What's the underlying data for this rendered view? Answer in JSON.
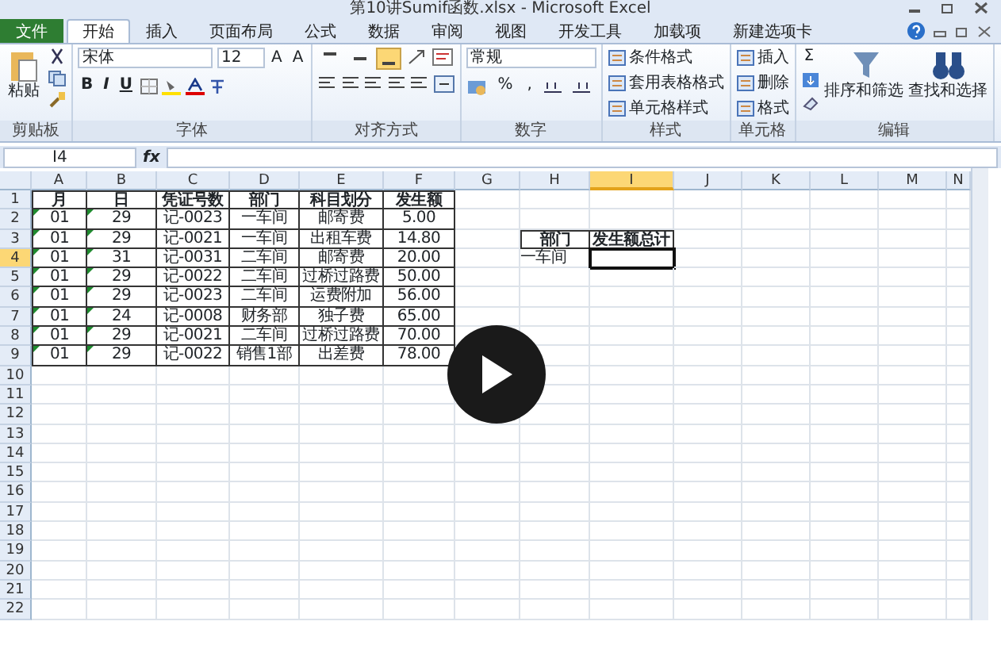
{
  "window": {
    "title": "第10讲Sumif函数.xlsx - Microsoft Excel"
  },
  "tabs": [
    {
      "label": "文件",
      "kind": "file",
      "selected": false
    },
    {
      "label": "开始",
      "kind": "tab",
      "selected": true
    },
    {
      "label": "插入",
      "kind": "tab",
      "selected": false
    },
    {
      "label": "页面布局",
      "kind": "tab",
      "selected": false
    },
    {
      "label": "公式",
      "kind": "tab",
      "selected": false
    },
    {
      "label": "数据",
      "kind": "tab",
      "selected": false
    },
    {
      "label": "审阅",
      "kind": "tab",
      "selected": false
    },
    {
      "label": "视图",
      "kind": "tab",
      "selected": false
    },
    {
      "label": "开发工具",
      "kind": "tab",
      "selected": false
    },
    {
      "label": "加载项",
      "kind": "tab",
      "selected": false
    },
    {
      "label": "新建选项卡",
      "kind": "tab",
      "selected": false
    }
  ],
  "ribbon": [
    {
      "label": "剪贴板",
      "kind": "clipboard",
      "command": "粘贴"
    },
    {
      "label": "字体",
      "kind": "font",
      "font_name": "宋体",
      "font_size": "12",
      "size_buttons": [
        "A",
        "A"
      ],
      "buttons": [
        "B",
        "I",
        "U"
      ]
    },
    {
      "label": "对齐方式",
      "kind": "alignment",
      "vertical_align": [
        {
          "selected": false
        },
        {
          "selected": false
        },
        {
          "selected": true
        }
      ]
    },
    {
      "label": "数字",
      "kind": "number",
      "format": "常规",
      "buttons": [
        "%",
        ","
      ]
    },
    {
      "label": "样式",
      "kind": "list",
      "items": [
        "条件格式",
        "套用表格格式",
        "单元格样式"
      ]
    },
    {
      "label": "单元格",
      "kind": "list",
      "items": [
        "插入",
        "删除",
        "格式"
      ]
    },
    {
      "label": "编辑",
      "kind": "editing",
      "sum": "Σ",
      "commands": [
        "排序和筛选",
        "查找和选择"
      ]
    }
  ],
  "formula_bar": {
    "name_box": "I4",
    "fx": "fx"
  },
  "columns": [
    {
      "label": "A",
      "selected": false
    },
    {
      "label": "B",
      "selected": false
    },
    {
      "label": "C",
      "selected": false
    },
    {
      "label": "D",
      "selected": false
    },
    {
      "label": "E",
      "selected": false
    },
    {
      "label": "F",
      "selected": false
    },
    {
      "label": "G",
      "selected": false
    },
    {
      "label": "H",
      "selected": false
    },
    {
      "label": "I",
      "selected": true
    },
    {
      "label": "J",
      "selected": false
    },
    {
      "label": "K",
      "selected": false
    },
    {
      "label": "L",
      "selected": false
    },
    {
      "label": "M",
      "selected": false
    },
    {
      "label": "N",
      "selected": false
    }
  ],
  "rows": [
    {
      "label": "1",
      "selected": false,
      "cells": [
        {
          "text": "月",
          "kind": "header"
        },
        {
          "text": "日",
          "kind": "header"
        },
        {
          "text": "凭证号数",
          "kind": "header"
        },
        {
          "text": "部门",
          "kind": "header"
        },
        {
          "text": "科目划分",
          "kind": "header"
        },
        {
          "text": "发生额",
          "kind": "header"
        }
      ]
    },
    {
      "label": "2",
      "selected": false,
      "cells": [
        {
          "text": "01",
          "kind": "text_number"
        },
        {
          "text": "29",
          "kind": "text_number"
        },
        {
          "text": "记-0023",
          "kind": "value"
        },
        {
          "text": "一车间",
          "kind": "value"
        },
        {
          "text": "邮寄费",
          "kind": "value"
        },
        {
          "text": "5.00",
          "kind": "value"
        }
      ]
    },
    {
      "label": "3",
      "selected": false,
      "cells": [
        {
          "text": "01",
          "kind": "text_number"
        },
        {
          "text": "29",
          "kind": "text_number"
        },
        {
          "text": "记-0021",
          "kind": "value"
        },
        {
          "text": "一车间",
          "kind": "value"
        },
        {
          "text": "出租车费",
          "kind": "value"
        },
        {
          "text": "14.80",
          "kind": "value"
        },
        null,
        {
          "text": "部门",
          "kind": "header"
        },
        {
          "text": "发生额总计",
          "kind": "header"
        }
      ]
    },
    {
      "label": "4",
      "selected": true,
      "cells": [
        {
          "text": "01",
          "kind": "text_number"
        },
        {
          "text": "31",
          "kind": "text_number"
        },
        {
          "text": "记-0031",
          "kind": "value"
        },
        {
          "text": "二车间",
          "kind": "value"
        },
        {
          "text": "邮寄费",
          "kind": "value"
        },
        {
          "text": "20.00",
          "kind": "value"
        },
        null,
        {
          "text": "一车间",
          "kind": "plain"
        },
        null
      ]
    },
    {
      "label": "5",
      "selected": false,
      "cells": [
        {
          "text": "01",
          "kind": "text_number"
        },
        {
          "text": "29",
          "kind": "text_number"
        },
        {
          "text": "记-0022",
          "kind": "value"
        },
        {
          "text": "二车间",
          "kind": "value"
        },
        {
          "text": "过桥过路费",
          "kind": "value"
        },
        {
          "text": "50.00",
          "kind": "value"
        }
      ]
    },
    {
      "label": "6",
      "selected": false,
      "cells": [
        {
          "text": "01",
          "kind": "text_number"
        },
        {
          "text": "29",
          "kind": "text_number"
        },
        {
          "text": "记-0023",
          "kind": "value"
        },
        {
          "text": "二车间",
          "kind": "value"
        },
        {
          "text": "运费附加",
          "kind": "value"
        },
        {
          "text": "56.00",
          "kind": "value"
        }
      ]
    },
    {
      "label": "7",
      "selected": false,
      "cells": [
        {
          "text": "01",
          "kind": "text_number"
        },
        {
          "text": "24",
          "kind": "text_number"
        },
        {
          "text": "记-0008",
          "kind": "value"
        },
        {
          "text": "财务部",
          "kind": "value"
        },
        {
          "text": "独子费",
          "kind": "value"
        },
        {
          "text": "65.00",
          "kind": "value"
        }
      ]
    },
    {
      "label": "8",
      "selected": false,
      "cells": [
        {
          "text": "01",
          "kind": "text_number"
        },
        {
          "text": "29",
          "kind": "text_number"
        },
        {
          "text": "记-0021",
          "kind": "value"
        },
        {
          "text": "二车间",
          "kind": "value"
        },
        {
          "text": "过桥过路费",
          "kind": "value"
        },
        {
          "text": "70.00",
          "kind": "value"
        }
      ]
    },
    {
      "label": "9",
      "selected": false,
      "cells": [
        {
          "text": "01",
          "kind": "text_number"
        },
        {
          "text": "29",
          "kind": "text_number"
        },
        {
          "text": "记-0022",
          "kind": "value"
        },
        {
          "text": "销售1部",
          "kind": "value"
        },
        {
          "text": "出差费",
          "kind": "value"
        },
        {
          "text": "78.00",
          "kind": "value"
        }
      ]
    },
    {
      "label": "10",
      "selected": false,
      "cells": []
    },
    {
      "label": "11",
      "selected": false,
      "cells": []
    },
    {
      "label": "12",
      "selected": false,
      "cells": []
    },
    {
      "label": "13",
      "selected": false,
      "cells": []
    },
    {
      "label": "14",
      "selected": false,
      "cells": []
    },
    {
      "label": "15",
      "selected": false,
      "cells": []
    },
    {
      "label": "16",
      "selected": false,
      "cells": []
    },
    {
      "label": "17",
      "selected": false,
      "cells": []
    },
    {
      "label": "18",
      "selected": false,
      "cells": []
    },
    {
      "label": "19",
      "selected": false,
      "cells": []
    },
    {
      "label": "20",
      "selected": false,
      "cells": []
    },
    {
      "label": "21",
      "selected": false,
      "cells": []
    },
    {
      "label": "22",
      "selected": false,
      "cells": []
    }
  ],
  "video_overlay": {
    "play_button": true
  }
}
